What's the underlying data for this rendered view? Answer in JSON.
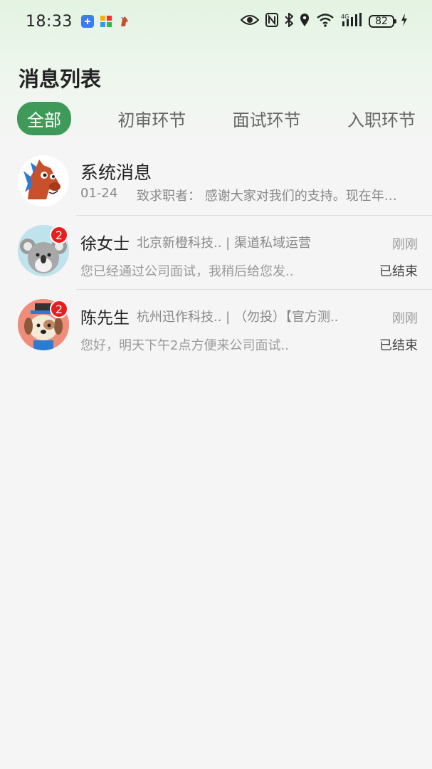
{
  "status_bar": {
    "time": "18:33",
    "battery": "82",
    "icons": [
      "eye-icon",
      "nfc-icon",
      "bluetooth-icon",
      "location-icon",
      "wifi-icon",
      "4g-signal-icon",
      "charging-icon"
    ]
  },
  "header": {
    "title": "消息列表"
  },
  "tabs": [
    {
      "label": "全部",
      "active": true
    },
    {
      "label": "初审环节",
      "active": false
    },
    {
      "label": "面试环节",
      "active": false
    },
    {
      "label": "入职环节",
      "active": false
    }
  ],
  "messages": [
    {
      "name": "系统消息",
      "date": "01-24",
      "preview": "致求职者：  感谢大家对我们的支持。现在年…",
      "avatar": "horse-avatar"
    },
    {
      "name": "徐女士",
      "company": "北京新橙科技.. | 渠道私域运营",
      "preview": "您已经通过公司面试，我稍后给您发..",
      "time": "刚刚",
      "status": "已结束",
      "badge": "2",
      "avatar": "koala-avatar"
    },
    {
      "name": "陈先生",
      "company": "杭州迅作科技.. | （勿投）【官方测..",
      "preview": "您好，明天下午2点方便来公司面试..",
      "time": "刚刚",
      "status": "已结束",
      "badge": "2",
      "avatar": "dog-avatar"
    }
  ],
  "colors": {
    "accent": "#3f9a5a",
    "badge": "#ea1d1d"
  }
}
